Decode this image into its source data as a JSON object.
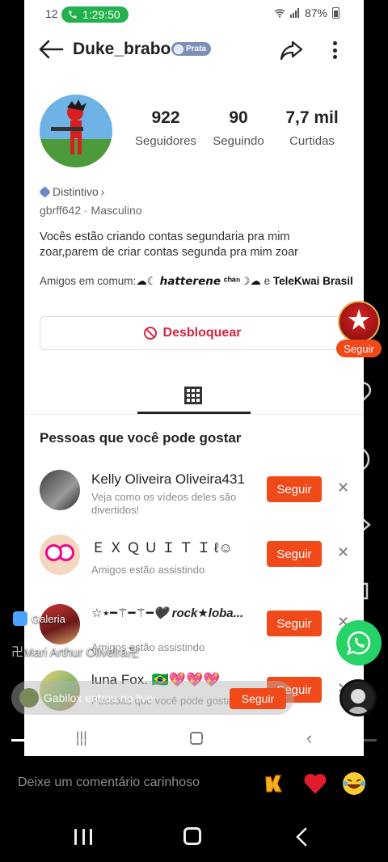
{
  "status_bar": {
    "time_left": "12",
    "call_time": "1:29:50",
    "battery": "87%"
  },
  "profile": {
    "username": "Duke_brabo",
    "level_badge": "Prata",
    "stats": [
      {
        "value": "922",
        "label": "Seguidores"
      },
      {
        "value": "90",
        "label": "Seguindo"
      },
      {
        "value": "7,7 mil",
        "label": "Curtidas"
      }
    ],
    "distintivo": "Distintivo",
    "id_line": "gbrff642 · Masculino",
    "bio": "Vocês estão criando contas segundaria pra mim zoar,parem de criar contas segunda pra mim zoar",
    "amigos_prefix": "Amigos em comum:",
    "amigos_friend1": "☁☾ 𝙝𝙖𝙩𝙩𝙚𝙧𝙚𝙣𝙚 ᶜʰᵃⁿ☽☁",
    "amigos_and": " e ",
    "amigos_friend2": "TeleKwai Brasil",
    "unblock_label": "Desbloquear"
  },
  "suggestions": {
    "title": "Pessoas que você pode gostar",
    "items": [
      {
        "name": "Kelly Oliveira Oliveira431",
        "subtitle": "Veja como os vídeos deles são divertidos!",
        "button": "Seguir"
      },
      {
        "name": "Ｅ Ｘ Ｑ Ｕ Ｉ Ｔ Ｉ  ℓ☺",
        "subtitle": "Amigos estão assistindo",
        "button": "Seguir"
      },
      {
        "name": "☆⋆━⚚━⚚━🖤 rock★loba...",
        "subtitle": "Amigos estão assistindo",
        "button": "Seguir"
      },
      {
        "name": "luna Fox. 🇧🇷💖💖💖",
        "subtitle": "Pessoas que você pode gostar",
        "button": "Seguir"
      }
    ]
  },
  "live_overlay": {
    "floating_follow": "Seguir",
    "galeria": "Galeria",
    "ghost_text": "卍Mari Arthur Oliveira卍",
    "guest_text": "Gabilox entrou no live",
    "guest_button": "Seguir",
    "progress": 0.1
  },
  "comment_bar": {
    "placeholder": "Deixe um comentário carinhoso"
  },
  "colors": {
    "accent": "#f0491a",
    "unblock": "#d7263d",
    "call_pill": "#22b14c",
    "whatsapp": "#25d366"
  }
}
